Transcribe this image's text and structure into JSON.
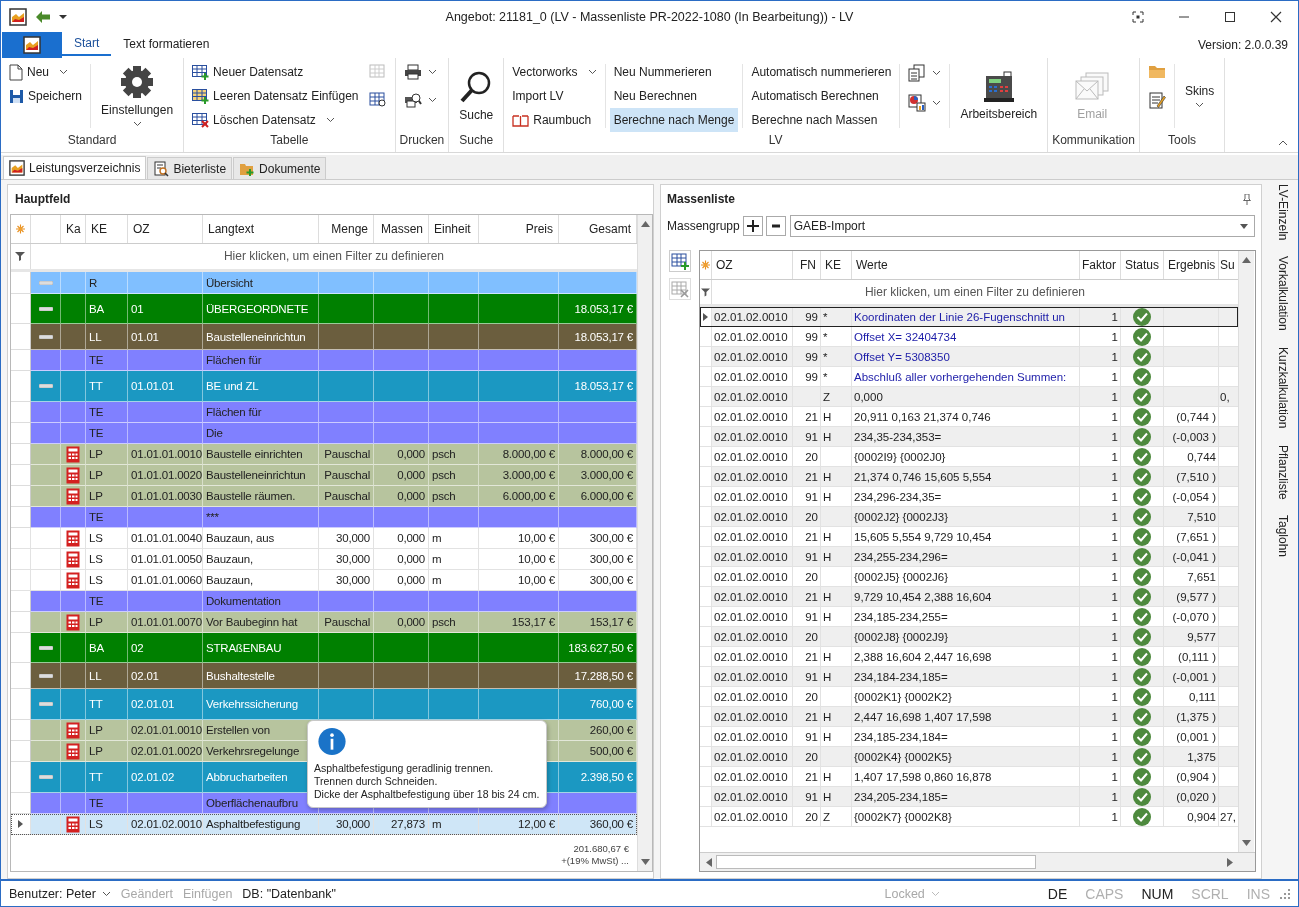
{
  "window": {
    "title": "Angebot: 21181_0  (LV - Massenliste PR-2022-1080 (In Bearbeitung)) - LV"
  },
  "ribbon": {
    "tabs": [
      {
        "label": "Start",
        "selected": true
      },
      {
        "label": "Text formatieren",
        "selected": false
      }
    ],
    "version": "Version: 2.0.0.39",
    "groups": [
      {
        "label": "Standard",
        "buttons": [
          {
            "label": "Neu",
            "dropdown": true
          },
          {
            "label": "Speichern"
          },
          {
            "label": "Einstellungen",
            "dropdown": true
          }
        ]
      },
      {
        "label": "Tabelle",
        "buttons": [
          {
            "label": "Neuer Datensatz"
          },
          {
            "label": "Leeren Datensatz Einfügen"
          },
          {
            "label": "Löschen Datensatz",
            "dropdown": true
          }
        ],
        "tools": [
          {
            "disabled": true
          },
          {
            "disabled": false
          }
        ]
      },
      {
        "label": "Drucken"
      },
      {
        "label": "Suche",
        "buttons": [
          {
            "label": "Suche"
          }
        ]
      },
      {
        "label": "LV",
        "buttons": [
          {
            "label": "Vectorworks",
            "dropdown": true,
            "selected": false
          },
          {
            "label": "Import LV",
            "selected": false
          },
          {
            "label": "Raumbuch",
            "selected": false
          },
          {
            "label": "Neu Nummerieren",
            "selected": false
          },
          {
            "label": "Neu Berechnen",
            "selected": false
          },
          {
            "label": "Berechne nach Menge",
            "selected": true
          },
          {
            "label": "Automatisch nummerieren",
            "selected": false
          },
          {
            "label": "Automatisch Berechnen",
            "selected": false
          },
          {
            "label": "Berechne nach Massen",
            "selected": false
          },
          {
            "label": "Arbeitsbereich",
            "selected": false
          }
        ]
      },
      {
        "label": "Kommunikation",
        "buttons": [
          {
            "label": "Email",
            "disabled": true
          }
        ]
      },
      {
        "label": "Tools",
        "buttons": [
          {
            "label": "Skins",
            "dropdown": true
          }
        ]
      }
    ]
  },
  "doc_tabs": [
    {
      "label": "Leistungsverzeichnis",
      "selected": true
    },
    {
      "label": "Bieterliste",
      "selected": false
    },
    {
      "label": "Dokumente",
      "selected": false
    }
  ],
  "main_table": {
    "title": "Hauptfeld",
    "columns": [
      "Ka",
      "KE",
      "OZ",
      "Langtext",
      "Menge",
      "Massen",
      "Einheit",
      "Preis",
      "Gesamt"
    ],
    "filter": "Hier klicken, um einen Filter zu definieren",
    "rows": [
      {
        "kind": "r",
        "expanded": true,
        "selected": false,
        "ke": "R",
        "text": "Übersicht"
      },
      {
        "kind": "ba",
        "expanded": true,
        "selected": false,
        "ke": "BA",
        "oz": "01",
        "text": "ÜBERGEORDNETE",
        "gesamt": "18.053,17 €"
      },
      {
        "kind": "ll",
        "expanded": true,
        "selected": false,
        "ke": "LL",
        "oz": "01.01",
        "text": "Baustelleneinrichtun",
        "gesamt": "18.053,17 €"
      },
      {
        "kind": "te",
        "selected": false,
        "ke": "TE",
        "text": "Flächen für"
      },
      {
        "kind": "tt",
        "expanded": true,
        "selected": false,
        "ke": "TT",
        "oz": "01.01.01",
        "text": "BE und ZL",
        "gesamt": "18.053,17 €"
      },
      {
        "kind": "te",
        "selected": false,
        "ke": "TE",
        "text": "Flächen für"
      },
      {
        "kind": "te",
        "selected": false,
        "ke": "TE",
        "text": "Die"
      },
      {
        "kind": "lp",
        "selected": false,
        "ke": "LP",
        "oz": "01.01.01.0010",
        "text": "Baustelle einrichten",
        "menge": "Pauschal",
        "massen": "0,000",
        "unit": "psch",
        "preis": "8.000,00 €",
        "gesamt": "8.000,00 €"
      },
      {
        "kind": "lp",
        "selected": false,
        "ke": "LP",
        "oz": "01.01.01.0020",
        "text": "Baustelleneinrichtun",
        "menge": "Pauschal",
        "massen": "0,000",
        "unit": "psch",
        "preis": "3.000,00 €",
        "gesamt": "3.000,00 €"
      },
      {
        "kind": "lp",
        "selected": false,
        "ke": "LP",
        "oz": "01.01.01.0030",
        "text": "Baustelle räumen.",
        "menge": "Pauschal",
        "massen": "0,000",
        "unit": "psch",
        "preis": "6.000,00 €",
        "gesamt": "6.000,00 €"
      },
      {
        "kind": "te",
        "selected": false,
        "ke": "TE",
        "text": "***"
      },
      {
        "kind": "ls",
        "selected": false,
        "ke": "LS",
        "oz": "01.01.01.0040",
        "text": "Bauzaun, aus",
        "menge": "30,000",
        "massen": "0,000",
        "unit": "m",
        "preis": "10,00 €",
        "gesamt": "300,00 €"
      },
      {
        "kind": "ls",
        "selected": false,
        "ke": "LS",
        "oz": "01.01.01.0050",
        "text": "Bauzaun,",
        "menge": "30,000",
        "massen": "0,000",
        "unit": "m",
        "preis": "10,00 €",
        "gesamt": "300,00 €"
      },
      {
        "kind": "ls",
        "selected": false,
        "ke": "LS",
        "oz": "01.01.01.0060",
        "text": "Bauzaun,",
        "menge": "30,000",
        "massen": "0,000",
        "unit": "m",
        "preis": "10,00 €",
        "gesamt": "300,00 €"
      },
      {
        "kind": "te",
        "selected": false,
        "ke": "TE",
        "text": "Dokumentation"
      },
      {
        "kind": "lp",
        "selected": false,
        "ke": "LP",
        "oz": "01.01.01.0070",
        "text": "Vor Baubeginn hat",
        "menge": "Pauschal",
        "massen": "0,000",
        "unit": "psch",
        "preis": "153,17 €",
        "gesamt": "153,17 €"
      },
      {
        "kind": "ba",
        "expanded": true,
        "selected": false,
        "ke": "BA",
        "oz": "02",
        "text": "STRAßENBAU",
        "gesamt": "183.627,50 €"
      },
      {
        "kind": "ll",
        "expanded": true,
        "selected": false,
        "ke": "LL",
        "oz": "02.01",
        "text": "Bushaltestelle",
        "gesamt": "17.288,50 €"
      },
      {
        "kind": "tt",
        "expanded": true,
        "selected": false,
        "ke": "TT",
        "oz": "02.01.01",
        "text": "Verkehrssicherung",
        "gesamt": "760,00 €"
      },
      {
        "kind": "lp",
        "selected": false,
        "ke": "LP",
        "oz": "02.01.01.0010",
        "text": "Erstellen von",
        "gesamt": "260,00 €"
      },
      {
        "kind": "lp",
        "selected": false,
        "ke": "LP",
        "oz": "02.01.01.0020",
        "text": "Verkehrsregelunge",
        "gesamt": "500,00 €"
      },
      {
        "kind": "tt",
        "expanded": true,
        "selected": false,
        "ke": "TT",
        "oz": "02.01.02",
        "text": "Abbrucharbeiten",
        "gesamt": "2.398,50 €"
      },
      {
        "kind": "te",
        "selected": false,
        "ke": "TE",
        "text": "Oberflächenaufbru"
      },
      {
        "kind": "ls",
        "selected": true,
        "ke": "LS",
        "oz": "02.01.02.0010",
        "text": "Asphaltbefestigung",
        "menge": "30,000",
        "massen": "27,873",
        "unit": "m",
        "preis": "12,00 €",
        "gesamt": "360,00 €"
      }
    ],
    "tooltip": "Asphaltbefestigung geradlinig trennen.\nTrennen durch Schneiden.\nDicke der Asphaltbefestigung über  18 bis 24 cm.",
    "total": "201.680,67 €",
    "tax": "+(19% MwSt) ..."
  },
  "mass_list": {
    "title": "Massenliste",
    "group_label": "Massengrupp",
    "group": "GAEB-Import",
    "columns": [
      "OZ",
      "FN",
      "KE",
      "Werte",
      "Faktor",
      "Status",
      "Ergebnis",
      "Su"
    ],
    "filter": "Hier klicken, um einen Filter zu definieren",
    "rows": [
      {
        "kind": "comment",
        "selected": true,
        "ok": true,
        "oz": "02.01.02.0010",
        "fn": "99",
        "ke": "*",
        "werte": "Koordinaten der Linie 26-Fugenschnitt un",
        "faktor": "1"
      },
      {
        "kind": "comment",
        "selected": false,
        "ok": true,
        "oz": "02.01.02.0010",
        "fn": "99",
        "ke": "*",
        "werte": "Offset X= 32404734",
        "faktor": "1"
      },
      {
        "kind": "comment",
        "selected": false,
        "ok": true,
        "oz": "02.01.02.0010",
        "fn": "99",
        "ke": "*",
        "werte": "Offset Y= 5308350",
        "faktor": "1"
      },
      {
        "kind": "comment",
        "selected": false,
        "ok": true,
        "oz": "02.01.02.0010",
        "fn": "99",
        "ke": "*",
        "werte": "Abschluß aller vorhergehenden Summen:",
        "faktor": "1"
      },
      {
        "kind": "calc",
        "selected": false,
        "ok": true,
        "oz": "02.01.02.0010",
        "ke": "Z",
        "werte": "0,000",
        "faktor": "1",
        "su": "0,"
      },
      {
        "kind": "calc",
        "selected": false,
        "ok": true,
        "oz": "02.01.02.0010",
        "fn": "21",
        "ke": "H",
        "werte": "20,911 0,163 21,374 0,746",
        "faktor": "1",
        "ergebnis": "(0,744 )"
      },
      {
        "kind": "calc",
        "selected": false,
        "ok": true,
        "oz": "02.01.02.0010",
        "fn": "91",
        "ke": "H",
        "werte": "234,35-234,353=",
        "faktor": "1",
        "ergebnis": "(-0,003 )"
      },
      {
        "kind": "calc",
        "selected": false,
        "ok": true,
        "oz": "02.01.02.0010",
        "fn": "20",
        "werte": "{0002I9} {0002J0}",
        "faktor": "1",
        "ergebnis": "0,744"
      },
      {
        "kind": "calc",
        "selected": false,
        "ok": true,
        "oz": "02.01.02.0010",
        "fn": "21",
        "ke": "H",
        "werte": "21,374 0,746 15,605 5,554",
        "faktor": "1",
        "ergebnis": "(7,510 )"
      },
      {
        "kind": "calc",
        "selected": false,
        "ok": true,
        "oz": "02.01.02.0010",
        "fn": "91",
        "ke": "H",
        "werte": "234,296-234,35=",
        "faktor": "1",
        "ergebnis": "(-0,054 )"
      },
      {
        "kind": "calc",
        "selected": false,
        "ok": true,
        "oz": "02.01.02.0010",
        "fn": "20",
        "werte": "{0002J2} {0002J3}",
        "faktor": "1",
        "ergebnis": "7,510"
      },
      {
        "kind": "calc",
        "selected": false,
        "ok": true,
        "oz": "02.01.02.0010",
        "fn": "21",
        "ke": "H",
        "werte": "15,605 5,554 9,729 10,454",
        "faktor": "1",
        "ergebnis": "(7,651 )"
      },
      {
        "kind": "calc",
        "selected": false,
        "ok": true,
        "oz": "02.01.02.0010",
        "fn": "91",
        "ke": "H",
        "werte": "234,255-234,296=",
        "faktor": "1",
        "ergebnis": "(-0,041 )"
      },
      {
        "kind": "calc",
        "selected": false,
        "ok": true,
        "oz": "02.01.02.0010",
        "fn": "20",
        "werte": "{0002J5} {0002J6}",
        "faktor": "1",
        "ergebnis": "7,651"
      },
      {
        "kind": "calc",
        "selected": false,
        "ok": true,
        "oz": "02.01.02.0010",
        "fn": "21",
        "ke": "H",
        "werte": "9,729 10,454 2,388 16,604",
        "faktor": "1",
        "ergebnis": "(9,577 )"
      },
      {
        "kind": "calc",
        "selected": false,
        "ok": true,
        "oz": "02.01.02.0010",
        "fn": "91",
        "ke": "H",
        "werte": "234,185-234,255=",
        "faktor": "1",
        "ergebnis": "(-0,070 )"
      },
      {
        "kind": "calc",
        "selected": false,
        "ok": true,
        "oz": "02.01.02.0010",
        "fn": "20",
        "werte": "{0002J8} {0002J9}",
        "faktor": "1",
        "ergebnis": "9,577"
      },
      {
        "kind": "calc",
        "selected": false,
        "ok": true,
        "oz": "02.01.02.0010",
        "fn": "21",
        "ke": "H",
        "werte": "2,388 16,604 2,447 16,698",
        "faktor": "1",
        "ergebnis": "(0,111 )"
      },
      {
        "kind": "calc",
        "selected": false,
        "ok": true,
        "oz": "02.01.02.0010",
        "fn": "91",
        "ke": "H",
        "werte": "234,184-234,185=",
        "faktor": "1",
        "ergebnis": "(-0,001 )"
      },
      {
        "kind": "calc",
        "selected": false,
        "ok": true,
        "oz": "02.01.02.0010",
        "fn": "20",
        "werte": "{0002K1} {0002K2}",
        "faktor": "1",
        "ergebnis": "0,111"
      },
      {
        "kind": "calc",
        "selected": false,
        "ok": true,
        "oz": "02.01.02.0010",
        "fn": "21",
        "ke": "H",
        "werte": "2,447 16,698 1,407 17,598",
        "faktor": "1",
        "ergebnis": "(1,375 )"
      },
      {
        "kind": "calc",
        "selected": false,
        "ok": true,
        "oz": "02.01.02.0010",
        "fn": "91",
        "ke": "H",
        "werte": "234,185-234,184=",
        "faktor": "1",
        "ergebnis": "(0,001 )"
      },
      {
        "kind": "calc",
        "selected": false,
        "ok": true,
        "oz": "02.01.02.0010",
        "fn": "20",
        "werte": "{0002K4} {0002K5}",
        "faktor": "1",
        "ergebnis": "1,375"
      },
      {
        "kind": "calc",
        "selected": false,
        "ok": true,
        "oz": "02.01.02.0010",
        "fn": "21",
        "ke": "H",
        "werte": "1,407 17,598 0,860 16,878",
        "faktor": "1",
        "ergebnis": "(0,904 )"
      },
      {
        "kind": "calc",
        "selected": false,
        "ok": true,
        "oz": "02.01.02.0010",
        "fn": "91",
        "ke": "H",
        "werte": "234,205-234,185=",
        "faktor": "1",
        "ergebnis": "(0,020 )"
      },
      {
        "kind": "calc",
        "selected": false,
        "ok": true,
        "oz": "02.01.02.0010",
        "fn": "20",
        "ke": "Z",
        "werte": "{0002K7} {0002K8}",
        "faktor": "1",
        "ergebnis": "0,904",
        "su": "27,"
      }
    ]
  },
  "side_tabs": [
    "LV-Einzeln",
    "Vorkalkulation",
    "Kurzkalkulation",
    "Pflanzliste",
    "Taglohn"
  ],
  "status_bar": {
    "user": "Benutzer: Peter",
    "flags": [
      {
        "label": "Geändert",
        "disabled": true
      },
      {
        "label": "Einfügen",
        "disabled": true
      }
    ],
    "db": "DB: \"Datenbank\"",
    "lock": {
      "label": "Locked",
      "disabled": true
    },
    "indicators": [
      {
        "label": "DE",
        "on": true
      },
      {
        "label": "CAPS",
        "on": false
      },
      {
        "label": "NUM",
        "on": true
      },
      {
        "label": "SCRL",
        "on": false
      },
      {
        "label": "INS",
        "on": false
      }
    ]
  }
}
